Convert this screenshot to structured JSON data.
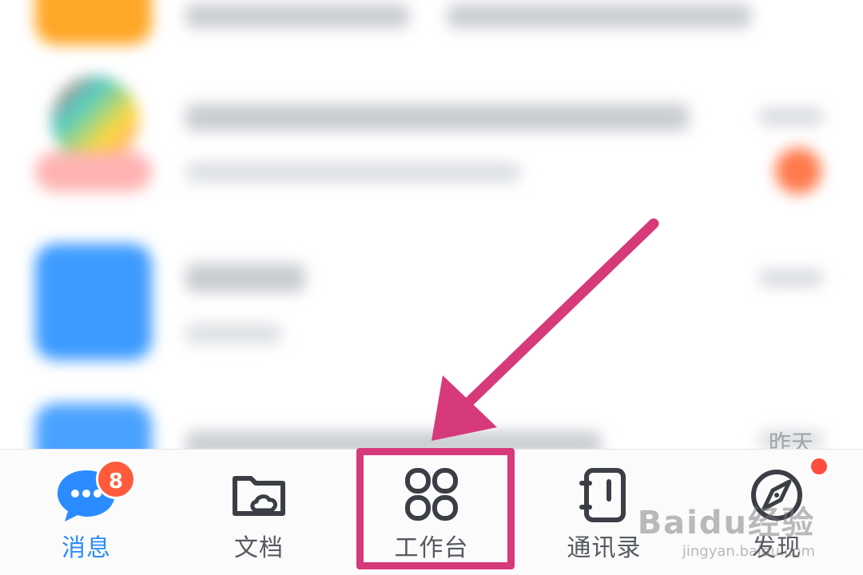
{
  "tabs": [
    {
      "id": "messages",
      "label": "消息",
      "badge": "8",
      "active": true,
      "icon": "chat-bubble-icon"
    },
    {
      "id": "documents",
      "label": "文档",
      "active": false,
      "icon": "cloud-folder-icon"
    },
    {
      "id": "workbench",
      "label": "工作台",
      "active": false,
      "icon": "grid-four-icon"
    },
    {
      "id": "contacts",
      "label": "通讯录",
      "active": false,
      "icon": "address-book-icon"
    },
    {
      "id": "discover",
      "label": "发现",
      "active": false,
      "icon": "compass-icon",
      "red_dot": true
    }
  ],
  "list": {
    "last_row_time": "昨天"
  },
  "watermark": {
    "brand": "Baidu经验",
    "url": "jingyan.baidu.com"
  },
  "colors": {
    "active": "#2b8cff",
    "badge": "#ff5a3c",
    "highlight": "#d63a7b",
    "inactive": "#555a60"
  }
}
